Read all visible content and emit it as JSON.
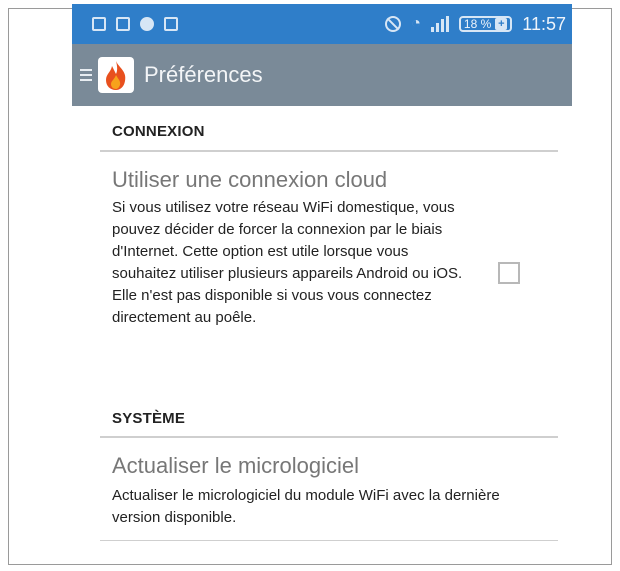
{
  "status_bar": {
    "battery": "18 %",
    "time": "11:57"
  },
  "app_bar": {
    "title": "Préférences"
  },
  "sections": [
    {
      "header": "CONNEXION",
      "pref_title": "Utiliser une connexion cloud",
      "pref_summary": "Si vous utilisez votre réseau WiFi domestique, vous pouvez décider de forcer la connexion par le biais d'Internet. Cette option est utile lorsque vous souhaitez utiliser plusieurs appareils Android ou iOS. Elle n'est pas disponible si vous vous connectez directement au poêle.",
      "checked": false
    },
    {
      "header": "SYSTÈME",
      "pref_title": "Actualiser le micrologiciel",
      "pref_summary": "Actualiser le micrologiciel du module WiFi avec la dernière version disponible."
    }
  ],
  "icons": {
    "app_logo": "flame-icon",
    "menu": "hamburger-icon"
  },
  "colors": {
    "status_bar": "#2f7ec9",
    "app_bar": "#7a8a98"
  }
}
